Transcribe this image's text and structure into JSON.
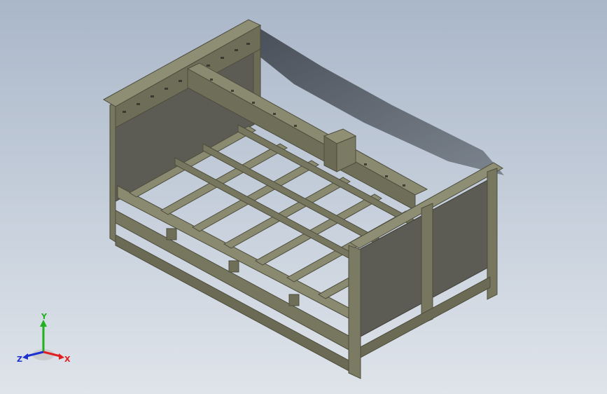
{
  "view": {
    "background_top": "#aab7c9",
    "background_bottom": "#dfe4ea",
    "model_color": "#77775f",
    "model_dark": "#55553f",
    "model_light": "#9a9a7e",
    "panel_color": "#5e5e56"
  },
  "triad": {
    "x_label": "X",
    "y_label": "Y",
    "z_label": "Z",
    "x_color": "#e02020",
    "y_color": "#20b020",
    "z_color": "#2030d0"
  }
}
